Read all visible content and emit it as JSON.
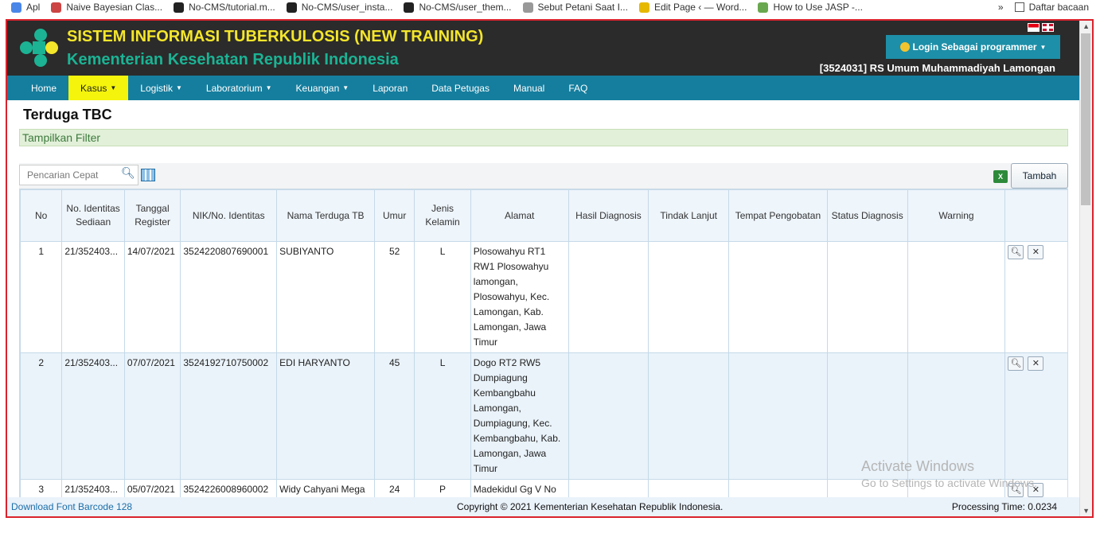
{
  "bookmarks": [
    "Apl",
    "Naive Bayesian Clas...",
    "No-CMS/tutorial.m...",
    "No-CMS/user_insta...",
    "No-CMS/user_them...",
    "Sebut Petani Saat I...",
    "Edit Page ‹ — Word...",
    "How to Use JASP -..."
  ],
  "bookmarks_more": "»",
  "reading_list": "Daftar bacaan",
  "header": {
    "title": "SISTEM INFORMASI TUBERKULOSIS (NEW TRAINING)",
    "subtitle": "Kementerian Kesehatan Republik Indonesia",
    "login": "Login Sebagai programmer",
    "hospital": "[3524031] RS Umum Muhammadiyah Lamongan"
  },
  "nav": [
    {
      "label": "Home",
      "dropdown": false
    },
    {
      "label": "Kasus",
      "dropdown": true,
      "active": true
    },
    {
      "label": "Logistik",
      "dropdown": true
    },
    {
      "label": "Laboratorium",
      "dropdown": true
    },
    {
      "label": "Keuangan",
      "dropdown": true
    },
    {
      "label": "Laporan",
      "dropdown": false
    },
    {
      "label": "Data Petugas",
      "dropdown": false
    },
    {
      "label": "Manual",
      "dropdown": false
    },
    {
      "label": "FAQ",
      "dropdown": false
    }
  ],
  "page": {
    "title": "Terduga TBC",
    "filter": "Tampilkan Filter"
  },
  "toolbar": {
    "search_placeholder": "Pencarian Cepat",
    "add": "Tambah"
  },
  "columns": [
    "No",
    "No. Identitas Sediaan",
    "Tanggal Register",
    "NIK/No. Identitas",
    "Nama Terduga TB",
    "Umur",
    "Jenis Kelamin",
    "Alamat",
    "Hasil Diagnosis",
    "Tindak Lanjut",
    "Tempat Pengobatan",
    "Status Diagnosis",
    "Warning",
    ""
  ],
  "rows": [
    {
      "no": "1",
      "id": "21/352403...",
      "date": "14/07/2021",
      "nik": "3524220807690001",
      "name": "SUBIYANTO",
      "age": "52",
      "sex": "L",
      "address": "Plosowahyu RT1 RW1 Plosowahyu lamongan, Plosowahyu, Kec. Lamongan, Kab. Lamongan, Jawa Timur"
    },
    {
      "no": "2",
      "id": "21/352403...",
      "date": "07/07/2021",
      "nik": "3524192710750002",
      "name": "EDI HARYANTO",
      "age": "45",
      "sex": "L",
      "address": "Dogo RT2 RW5 Dumpiagung Kembangbahu Lamongan, Dumpiagung, Kec. Kembangbahu, Kab. Lamongan, Jawa Timur"
    },
    {
      "no": "3",
      "id": "21/352403...",
      "date": "05/07/2021",
      "nik": "3524226008960002",
      "name": "Widy Cahyani Mega",
      "age": "24",
      "sex": "P",
      "address": "Madekidul Gg V No"
    }
  ],
  "footer": {
    "download": "Download Font Barcode 128",
    "copyright": "Copyright © 2021 Kementerian Kesehatan Republik Indonesia.",
    "processing": "Processing Time: 0.0234"
  },
  "watermark": {
    "line1": "Activate Windows",
    "line2": "Go to Settings to activate Windows."
  },
  "colors": {
    "header_bg": "#2b2b2b",
    "title": "#f4e62b",
    "subtitle": "#1bb394",
    "nav_bg": "#157e9e",
    "nav_active": "#f4f40c",
    "frame_border": "#d9232d"
  }
}
